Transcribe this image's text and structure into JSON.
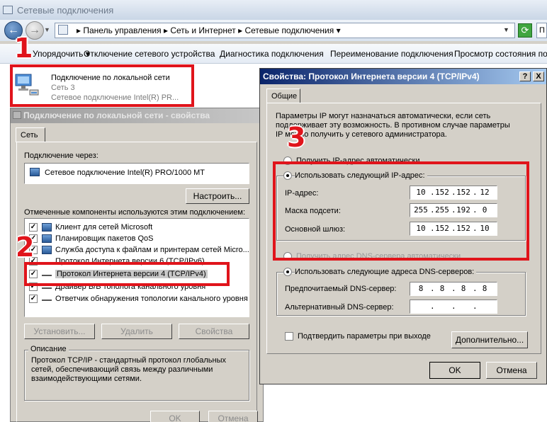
{
  "window": {
    "title": "Сетевые подключения",
    "breadcrumb": [
      "Панель управления",
      "Сеть и Интернет",
      "Сетевые подключения"
    ],
    "search_hint": "П"
  },
  "cmdbar": {
    "organize": "Упорядочить",
    "disable": "Отключение сетевого устройства",
    "diagnose": "Диагностика подключения",
    "rename": "Переименование подключения",
    "status": "Просмотр состояния подк"
  },
  "connection": {
    "name": "Подключение по локальной сети",
    "network": "Сеть  3",
    "adapter": "Сетевое подключение Intel(R) PR..."
  },
  "props": {
    "title": "Подключение по локальной сети - свойства",
    "tab": "Сеть",
    "connect_via_label": "Подключение через:",
    "adapter": "Сетевое подключение Intel(R) PRO/1000 MT",
    "configure": "Настроить...",
    "components_label": "Отмеченные компоненты используются этим подключением:",
    "components": [
      {
        "label": "Клиент для сетей Microsoft",
        "checked": true
      },
      {
        "label": "Планировщик пакетов QoS",
        "checked": true
      },
      {
        "label": "Служба доступа к файлам и принтерам сетей Micro...",
        "checked": true
      },
      {
        "label": "Протокол Интернета версии 6 (TCP/IPv6)",
        "checked": true
      },
      {
        "label": "Протокол Интернета версии 4 (TCP/IPv4)",
        "checked": true
      },
      {
        "label": "Драйвер В/В тополога канального уровня",
        "checked": true
      },
      {
        "label": "Ответчик обнаружения топологии канального уровня",
        "checked": true
      }
    ],
    "install": "Установить...",
    "remove": "Удалить",
    "properties": "Свойства",
    "description_title": "Описание",
    "description": "Протокол TCP/IP - стандартный протокол глобальных сетей, обеспечивающий связь между различными взаимодействующими сетями.",
    "ok": "OK",
    "cancel": "Отмена"
  },
  "ipv4": {
    "title": "Свойства: Протокол Интернета версии 4 (TCP/IPv4)",
    "help": "?",
    "close": "X",
    "tab": "Общие",
    "intro": "Параметры IP могут назначаться автоматически, если сеть поддерживает эту возможность. В противном случае параметры IP можно получить у сетевого администратора.",
    "auto_ip": "Получить IP-адрес автоматически",
    "manual_ip": "Использовать следующий IP-адрес:",
    "ip_label": "IP-адрес:",
    "ip": [
      "10",
      "152",
      "152",
      "12"
    ],
    "mask_label": "Маска подсети:",
    "mask": [
      "255",
      "255",
      "192",
      "0"
    ],
    "gw_label": "Основной шлюз:",
    "gw": [
      "10",
      "152",
      "152",
      "10"
    ],
    "auto_dns": "Получить адрес DNS-сервера автоматически",
    "manual_dns": "Использовать следующие адреса DNS-серверов:",
    "pref_dns_label": "Предпочитаемый DNS-сервер:",
    "pref_dns": [
      "8",
      "8",
      "8",
      "8"
    ],
    "alt_dns_label": "Альтернативный DNS-сервер:",
    "alt_dns": [
      "",
      "",
      "",
      ""
    ],
    "validate": "Подтвердить параметры при выходе",
    "advanced": "Дополнительно...",
    "ok": "OK",
    "cancel": "Отмена"
  },
  "annotations": {
    "step1": "1",
    "step2": "2",
    "step3": "3"
  },
  "colors": {
    "annotation": "#e0141b",
    "active_title": "#0a246a"
  }
}
